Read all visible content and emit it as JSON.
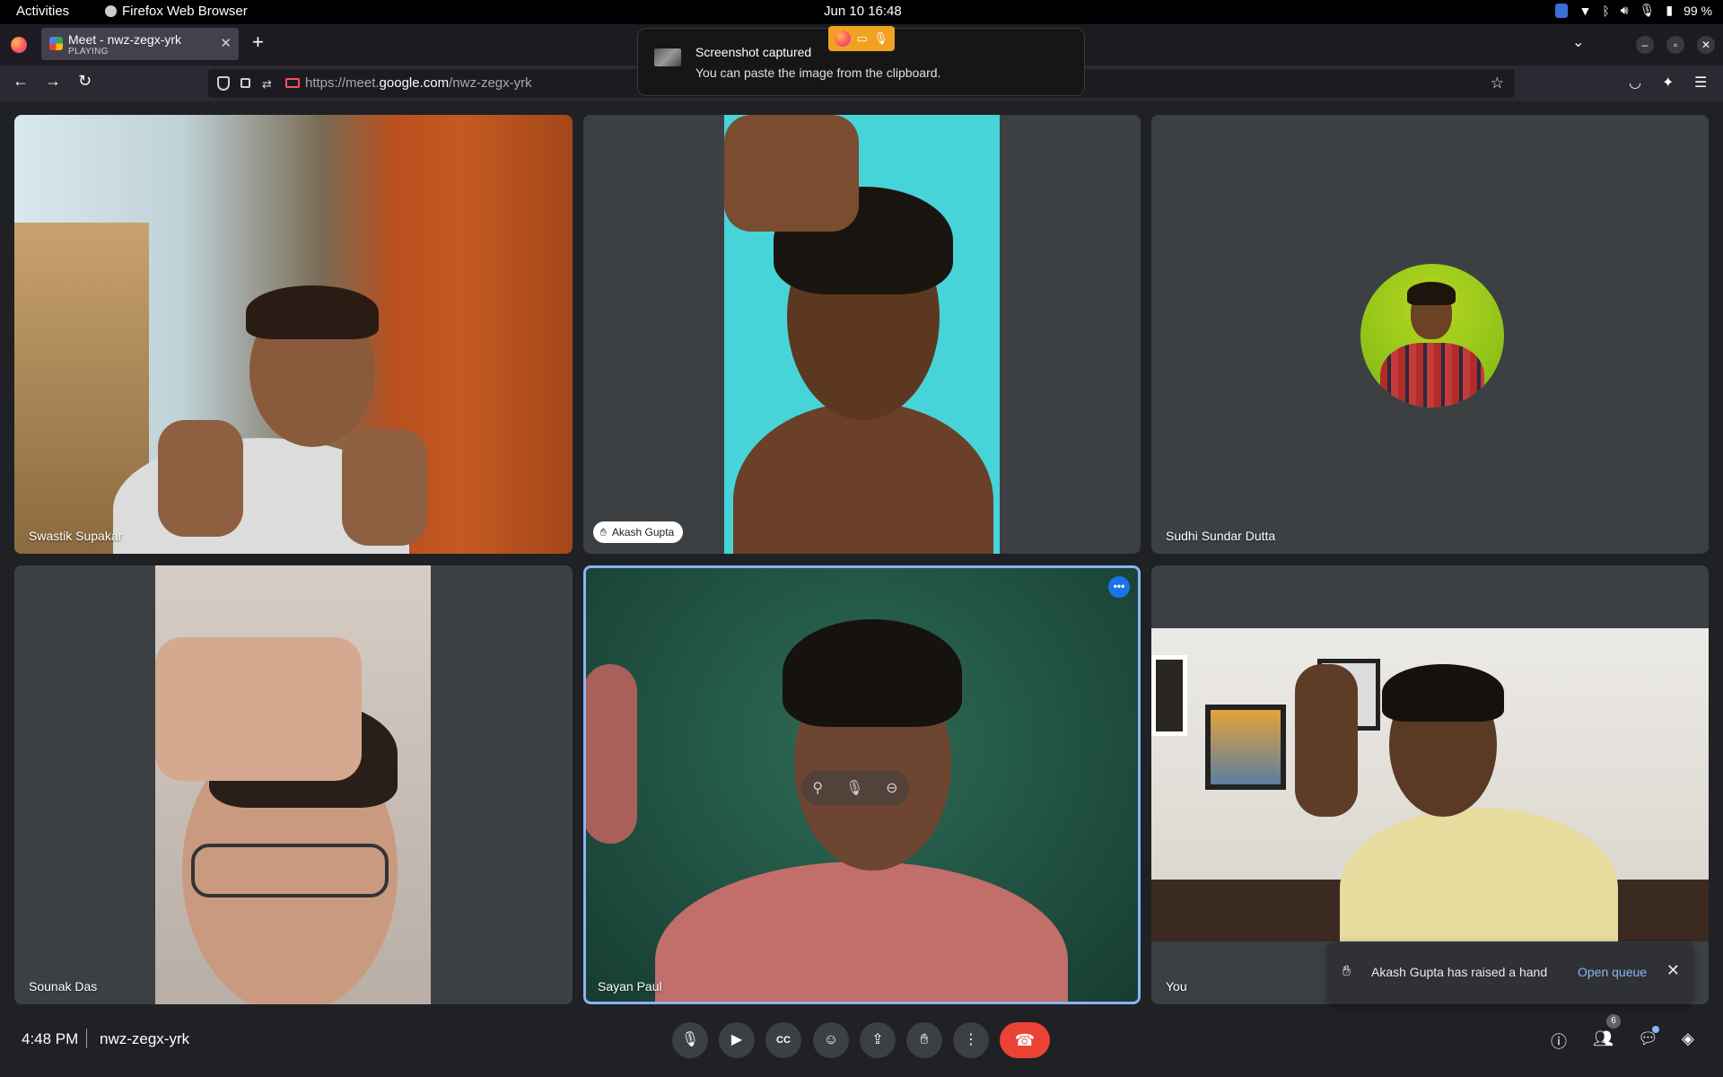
{
  "topbar": {
    "activities": "Activities",
    "app_name": "Firefox Web Browser",
    "clock": "Jun 10  16:48",
    "battery": "99 %"
  },
  "browser": {
    "tab_title": "Meet - nwz-zegx-yrk",
    "tab_status": "PLAYING",
    "url_prefix": "https://meet.",
    "url_domain": "google.com",
    "url_path": "/nwz-zegx-yrk"
  },
  "notification": {
    "title": "Screenshot captured",
    "body": "You can paste the image from the clipboard."
  },
  "participants": [
    {
      "name": "Swastik Supakar"
    },
    {
      "name": "Akash Gupta"
    },
    {
      "name": "Sudhi Sundar Dutta"
    },
    {
      "name": "Sounak Das"
    },
    {
      "name": "Sayan Paul"
    },
    {
      "name": "You"
    }
  ],
  "toast": {
    "text": "Akash Gupta has raised a hand",
    "action": "Open queue"
  },
  "meeting": {
    "time": "4:48 PM",
    "code": "nwz-zegx-yrk",
    "people_count": "6"
  },
  "colors": {
    "background": "#202124",
    "tile": "#3c4043",
    "end_call": "#ea4335",
    "accent": "#8ab4f8"
  },
  "icons": {
    "controls": [
      "mic-icon",
      "camera-icon",
      "captions-icon",
      "emoji-icon",
      "present-icon",
      "raise-hand-icon",
      "more-options-icon",
      "end-call-icon"
    ],
    "right": [
      "info-icon",
      "people-icon",
      "chat-icon",
      "activities-icon"
    ]
  }
}
